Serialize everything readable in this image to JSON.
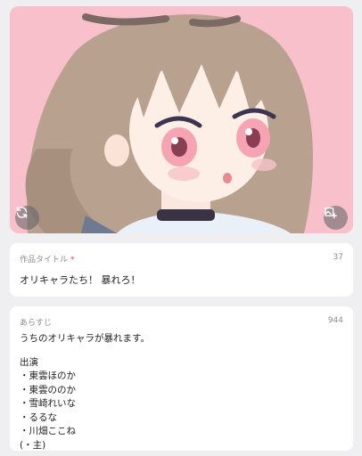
{
  "colors": {
    "background": "#efeff2",
    "card": "#ffffff",
    "label": "#8c8c8c",
    "required": "#e0435a",
    "cover_pink": "#f7c0cb",
    "hair": "#b9a190"
  },
  "cover": {
    "description_icon_left": "refresh-icon",
    "description_icon_right": "image-edit-icon"
  },
  "title_field": {
    "label": "作品タイトル",
    "required_mark": "*",
    "count": "37",
    "value": "オリキャラたち！ 暴れろ！"
  },
  "synopsis_field": {
    "label": "あらすじ",
    "count": "944",
    "lines": [
      "うちのオリキャラが暴れます。",
      "",
      "出演",
      "・東雲ほのか",
      "・東雲ののか",
      "・雪崎れいな",
      "・るるな",
      "・川畑ここね",
      "(・主)"
    ]
  }
}
